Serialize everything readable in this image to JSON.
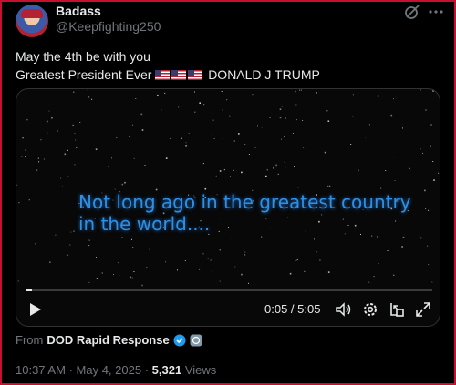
{
  "author": {
    "name": "Badass",
    "handle": "@Keepfighting250"
  },
  "post": {
    "line1": "May the 4th be with you",
    "line2_prefix": "Greatest President Ever",
    "line2_suffix": "DONALD J TRUMP",
    "flag_count": 3
  },
  "video": {
    "caption_line1": "Not long ago in the greatest country",
    "caption_line2": "in the world....",
    "time_display": "0:05 / 5:05",
    "progress_fraction": 0.016
  },
  "source": {
    "from_label": "From",
    "name": "DOD Rapid Response"
  },
  "meta": {
    "time": "10:37 AM",
    "separator": "·",
    "date": "May 4, 2025",
    "views_count": "5,321",
    "views_label": "Views"
  },
  "icons": [
    "grok-icon",
    "more-icon",
    "play-icon",
    "volume-icon",
    "settings-icon",
    "pip-icon",
    "fullscreen-icon",
    "verified-badge-icon",
    "gov-badge-icon"
  ],
  "colors": {
    "caption": "#2f8fe0",
    "verified": "#1d9bf0",
    "border": "#c8102e"
  }
}
